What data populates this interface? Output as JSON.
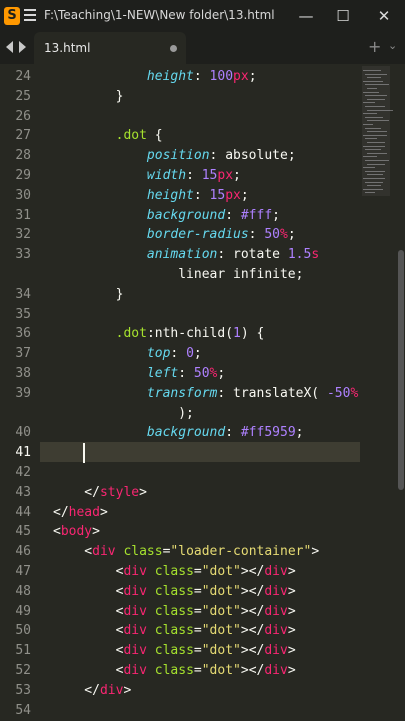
{
  "titlebar": {
    "title": "F:\\Teaching\\1-NEW\\New folder\\13.html • - Subli...",
    "app_icon_letter": "S",
    "minimize": "—",
    "maximize": "☐",
    "close": "✕"
  },
  "tabs": [
    {
      "label": "13.html",
      "modified": true
    }
  ],
  "tabbar": {
    "plus": "+",
    "chevron": "⌄"
  },
  "editor": {
    "active_line": "41",
    "lines": [
      {
        "n": "24",
        "tokens": [
          {
            "t": "            "
          },
          {
            "t": "height",
            "c": "prop"
          },
          {
            "t": ": "
          },
          {
            "t": "100",
            "c": "num"
          },
          {
            "t": "px",
            "c": "kw"
          },
          {
            "t": ";"
          }
        ]
      },
      {
        "n": "25",
        "tokens": [
          {
            "t": "        }"
          }
        ]
      },
      {
        "n": "26",
        "tokens": []
      },
      {
        "n": "27",
        "tokens": [
          {
            "t": "        "
          },
          {
            "t": ".dot",
            "c": "sel"
          },
          {
            "t": " {"
          }
        ]
      },
      {
        "n": "28",
        "tokens": [
          {
            "t": "            "
          },
          {
            "t": "position",
            "c": "prop"
          },
          {
            "t": ": absolute;"
          }
        ]
      },
      {
        "n": "29",
        "tokens": [
          {
            "t": "            "
          },
          {
            "t": "width",
            "c": "prop"
          },
          {
            "t": ": "
          },
          {
            "t": "15",
            "c": "num"
          },
          {
            "t": "px",
            "c": "kw"
          },
          {
            "t": ";"
          }
        ]
      },
      {
        "n": "30",
        "tokens": [
          {
            "t": "            "
          },
          {
            "t": "height",
            "c": "prop"
          },
          {
            "t": ": "
          },
          {
            "t": "15",
            "c": "num"
          },
          {
            "t": "px",
            "c": "kw"
          },
          {
            "t": ";"
          }
        ]
      },
      {
        "n": "31",
        "tokens": [
          {
            "t": "            "
          },
          {
            "t": "background",
            "c": "prop"
          },
          {
            "t": ": "
          },
          {
            "t": "#fff",
            "c": "num"
          },
          {
            "t": ";"
          }
        ]
      },
      {
        "n": "32",
        "tokens": [
          {
            "t": "            "
          },
          {
            "t": "border-radius",
            "c": "prop"
          },
          {
            "t": ": "
          },
          {
            "t": "50",
            "c": "num"
          },
          {
            "t": "%",
            "c": "kw"
          },
          {
            "t": ";"
          }
        ]
      },
      {
        "n": "33",
        "tokens": [
          {
            "t": "            "
          },
          {
            "t": "animation",
            "c": "prop"
          },
          {
            "t": ": rotate "
          },
          {
            "t": "1.5",
            "c": "num"
          },
          {
            "t": "s",
            "c": "kw"
          }
        ]
      },
      {
        "n": "",
        "tokens": [
          {
            "t": "                linear infinite;"
          }
        ]
      },
      {
        "n": "34",
        "tokens": [
          {
            "t": "        }"
          }
        ]
      },
      {
        "n": "35",
        "tokens": []
      },
      {
        "n": "36",
        "tokens": [
          {
            "t": "        "
          },
          {
            "t": ".dot",
            "c": "sel"
          },
          {
            "t": ":nth-child("
          },
          {
            "t": "1",
            "c": "num"
          },
          {
            "t": ") {"
          }
        ]
      },
      {
        "n": "37",
        "tokens": [
          {
            "t": "            "
          },
          {
            "t": "top",
            "c": "prop"
          },
          {
            "t": ": "
          },
          {
            "t": "0",
            "c": "num"
          },
          {
            "t": ";"
          }
        ]
      },
      {
        "n": "38",
        "tokens": [
          {
            "t": "            "
          },
          {
            "t": "left",
            "c": "prop"
          },
          {
            "t": ": "
          },
          {
            "t": "50",
            "c": "num"
          },
          {
            "t": "%",
            "c": "kw"
          },
          {
            "t": ";"
          }
        ]
      },
      {
        "n": "39",
        "tokens": [
          {
            "t": "            "
          },
          {
            "t": "transform",
            "c": "prop"
          },
          {
            "t": ": translateX( "
          },
          {
            "t": "-50",
            "c": "num"
          },
          {
            "t": "%",
            "c": "kw"
          }
        ]
      },
      {
        "n": "",
        "tokens": [
          {
            "t": "                );"
          }
        ]
      },
      {
        "n": "40",
        "tokens": [
          {
            "t": "            "
          },
          {
            "t": "background",
            "c": "prop"
          },
          {
            "t": ": "
          },
          {
            "t": "#ff5959",
            "c": "num"
          },
          {
            "t": ";"
          }
        ]
      },
      {
        "n": "41",
        "tokens": []
      },
      {
        "n": "42",
        "tokens": []
      },
      {
        "n": "43",
        "tokens": [
          {
            "t": "    </"
          },
          {
            "t": "style",
            "c": "tag"
          },
          {
            "t": ">"
          }
        ]
      },
      {
        "n": "44",
        "tokens": [
          {
            "t": "</"
          },
          {
            "t": "head",
            "c": "tag"
          },
          {
            "t": ">"
          }
        ]
      },
      {
        "n": "45",
        "tokens": [
          {
            "t": "<"
          },
          {
            "t": "body",
            "c": "tag"
          },
          {
            "t": ">"
          }
        ]
      },
      {
        "n": "46",
        "tokens": [
          {
            "t": "    <"
          },
          {
            "t": "div",
            "c": "tag"
          },
          {
            "t": " "
          },
          {
            "t": "class",
            "c": "attr"
          },
          {
            "t": "="
          },
          {
            "t": "\"loader-container\"",
            "c": "str"
          },
          {
            "t": ">"
          }
        ]
      },
      {
        "n": "47",
        "tokens": [
          {
            "t": "        <"
          },
          {
            "t": "div",
            "c": "tag"
          },
          {
            "t": " "
          },
          {
            "t": "class",
            "c": "attr"
          },
          {
            "t": "="
          },
          {
            "t": "\"dot\"",
            "c": "str"
          },
          {
            "t": "></"
          },
          {
            "t": "div",
            "c": "tag"
          },
          {
            "t": ">"
          }
        ]
      },
      {
        "n": "48",
        "tokens": [
          {
            "t": "        <"
          },
          {
            "t": "div",
            "c": "tag"
          },
          {
            "t": " "
          },
          {
            "t": "class",
            "c": "attr"
          },
          {
            "t": "="
          },
          {
            "t": "\"dot\"",
            "c": "str"
          },
          {
            "t": "></"
          },
          {
            "t": "div",
            "c": "tag"
          },
          {
            "t": ">"
          }
        ]
      },
      {
        "n": "49",
        "tokens": [
          {
            "t": "        <"
          },
          {
            "t": "div",
            "c": "tag"
          },
          {
            "t": " "
          },
          {
            "t": "class",
            "c": "attr"
          },
          {
            "t": "="
          },
          {
            "t": "\"dot\"",
            "c": "str"
          },
          {
            "t": "></"
          },
          {
            "t": "div",
            "c": "tag"
          },
          {
            "t": ">"
          }
        ]
      },
      {
        "n": "50",
        "tokens": [
          {
            "t": "        <"
          },
          {
            "t": "div",
            "c": "tag"
          },
          {
            "t": " "
          },
          {
            "t": "class",
            "c": "attr"
          },
          {
            "t": "="
          },
          {
            "t": "\"dot\"",
            "c": "str"
          },
          {
            "t": "></"
          },
          {
            "t": "div",
            "c": "tag"
          },
          {
            "t": ">"
          }
        ]
      },
      {
        "n": "51",
        "tokens": [
          {
            "t": "        <"
          },
          {
            "t": "div",
            "c": "tag"
          },
          {
            "t": " "
          },
          {
            "t": "class",
            "c": "attr"
          },
          {
            "t": "="
          },
          {
            "t": "\"dot\"",
            "c": "str"
          },
          {
            "t": "></"
          },
          {
            "t": "div",
            "c": "tag"
          },
          {
            "t": ">"
          }
        ]
      },
      {
        "n": "52",
        "tokens": [
          {
            "t": "        <"
          },
          {
            "t": "div",
            "c": "tag"
          },
          {
            "t": " "
          },
          {
            "t": "class",
            "c": "attr"
          },
          {
            "t": "="
          },
          {
            "t": "\"dot\"",
            "c": "str"
          },
          {
            "t": "></"
          },
          {
            "t": "div",
            "c": "tag"
          },
          {
            "t": ">"
          }
        ]
      },
      {
        "n": "53",
        "tokens": [
          {
            "t": "    </"
          },
          {
            "t": "div",
            "c": "tag"
          },
          {
            "t": ">"
          }
        ]
      },
      {
        "n": "54",
        "tokens": []
      }
    ]
  },
  "colors": {
    "background": "#272822",
    "chrome": "#1e1f1c",
    "tag": "#f92672",
    "attribute": "#a6e22e",
    "string": "#e6db74",
    "property": "#66d9ef",
    "number": "#ae81ff",
    "app_icon": "#ff9800"
  }
}
